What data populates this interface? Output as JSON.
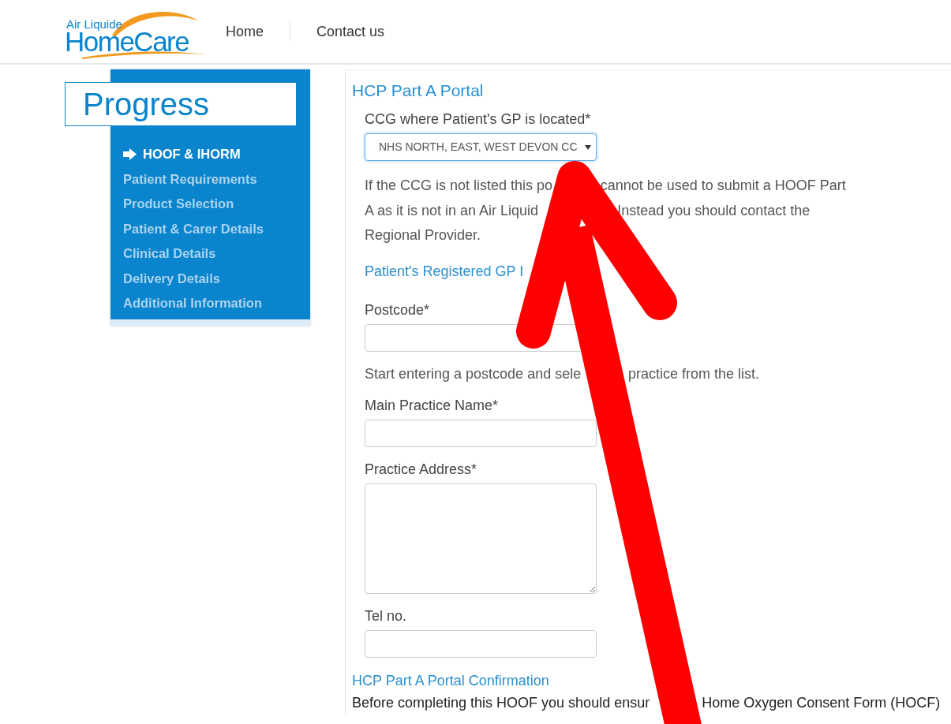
{
  "header": {
    "logo": {
      "small": "Air Liquide",
      "large": "HomeCare"
    },
    "nav": [
      "Home",
      "Contact us"
    ]
  },
  "sidebar": {
    "title": "Progress",
    "steps": [
      {
        "label": "HOOF & IHORM",
        "selected": true
      },
      {
        "label": "Patient Requirements",
        "selected": false
      },
      {
        "label": "Product Selection",
        "selected": false
      },
      {
        "label": "Patient & Carer Details",
        "selected": false
      },
      {
        "label": "Clinical Details",
        "selected": false
      },
      {
        "label": "Delivery Details",
        "selected": false
      },
      {
        "label": "Additional Information",
        "selected": false
      }
    ]
  },
  "form": {
    "title": "HCP Part A Portal",
    "ccg": {
      "label": "CCG where Patient's GP is located*",
      "value": "NHS NORTH, EAST, WEST DEVON CC"
    },
    "ccg_note": [
      [
        "If the CCG is not listed this po",
        "cannot be used to submit a HOOF Part"
      ],
      [
        "A as it is not in an Air Liquid",
        "Instead you should contact the"
      ],
      [
        "Regional Provider."
      ]
    ],
    "gp_heading": "Patient's Registered GP I",
    "fields": [
      {
        "kind": "input",
        "label": "Postcode*",
        "hint": [
          "Start entering a postcode and sele",
          "practice from the list."
        ]
      },
      {
        "kind": "input",
        "label": "Main Practice Name*"
      },
      {
        "kind": "textarea",
        "label": "Practice Address*"
      },
      {
        "kind": "input",
        "label": "Tel no."
      }
    ],
    "confirmation_heading": "HCP Part A Portal Confirmation",
    "confirmation_text": [
      "Before completing this HOOF you should ensur",
      "Home Oxygen Consent Form (HOCF)"
    ]
  }
}
